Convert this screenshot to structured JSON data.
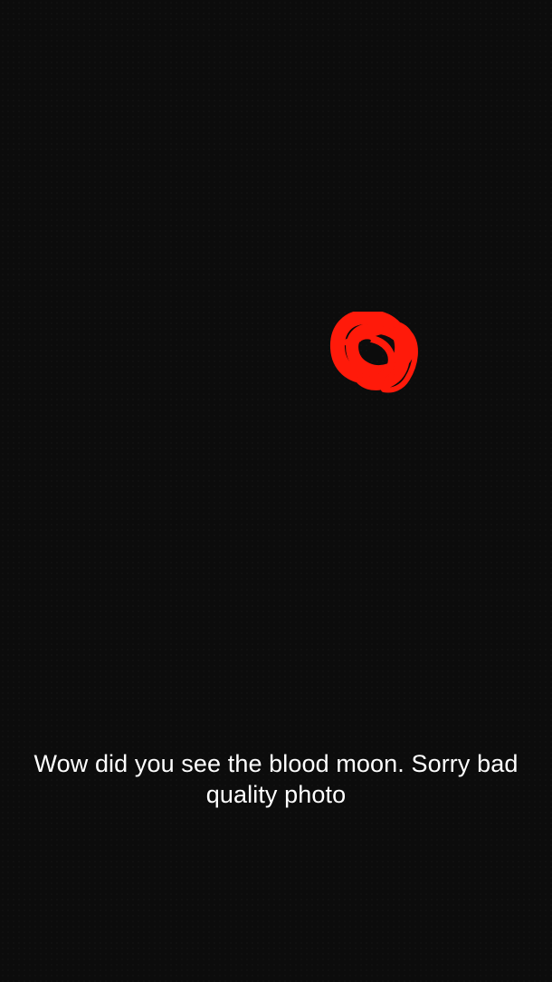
{
  "caption": {
    "line1": "Wow did you see the blood moon. Sorry bad",
    "line2": "quality photo"
  },
  "colors": {
    "background": "#0c0c0c",
    "doodle": "#ff1a0a",
    "caption_text": "#ffffff"
  },
  "drawing": {
    "icon": "red-scribble-drawing"
  }
}
